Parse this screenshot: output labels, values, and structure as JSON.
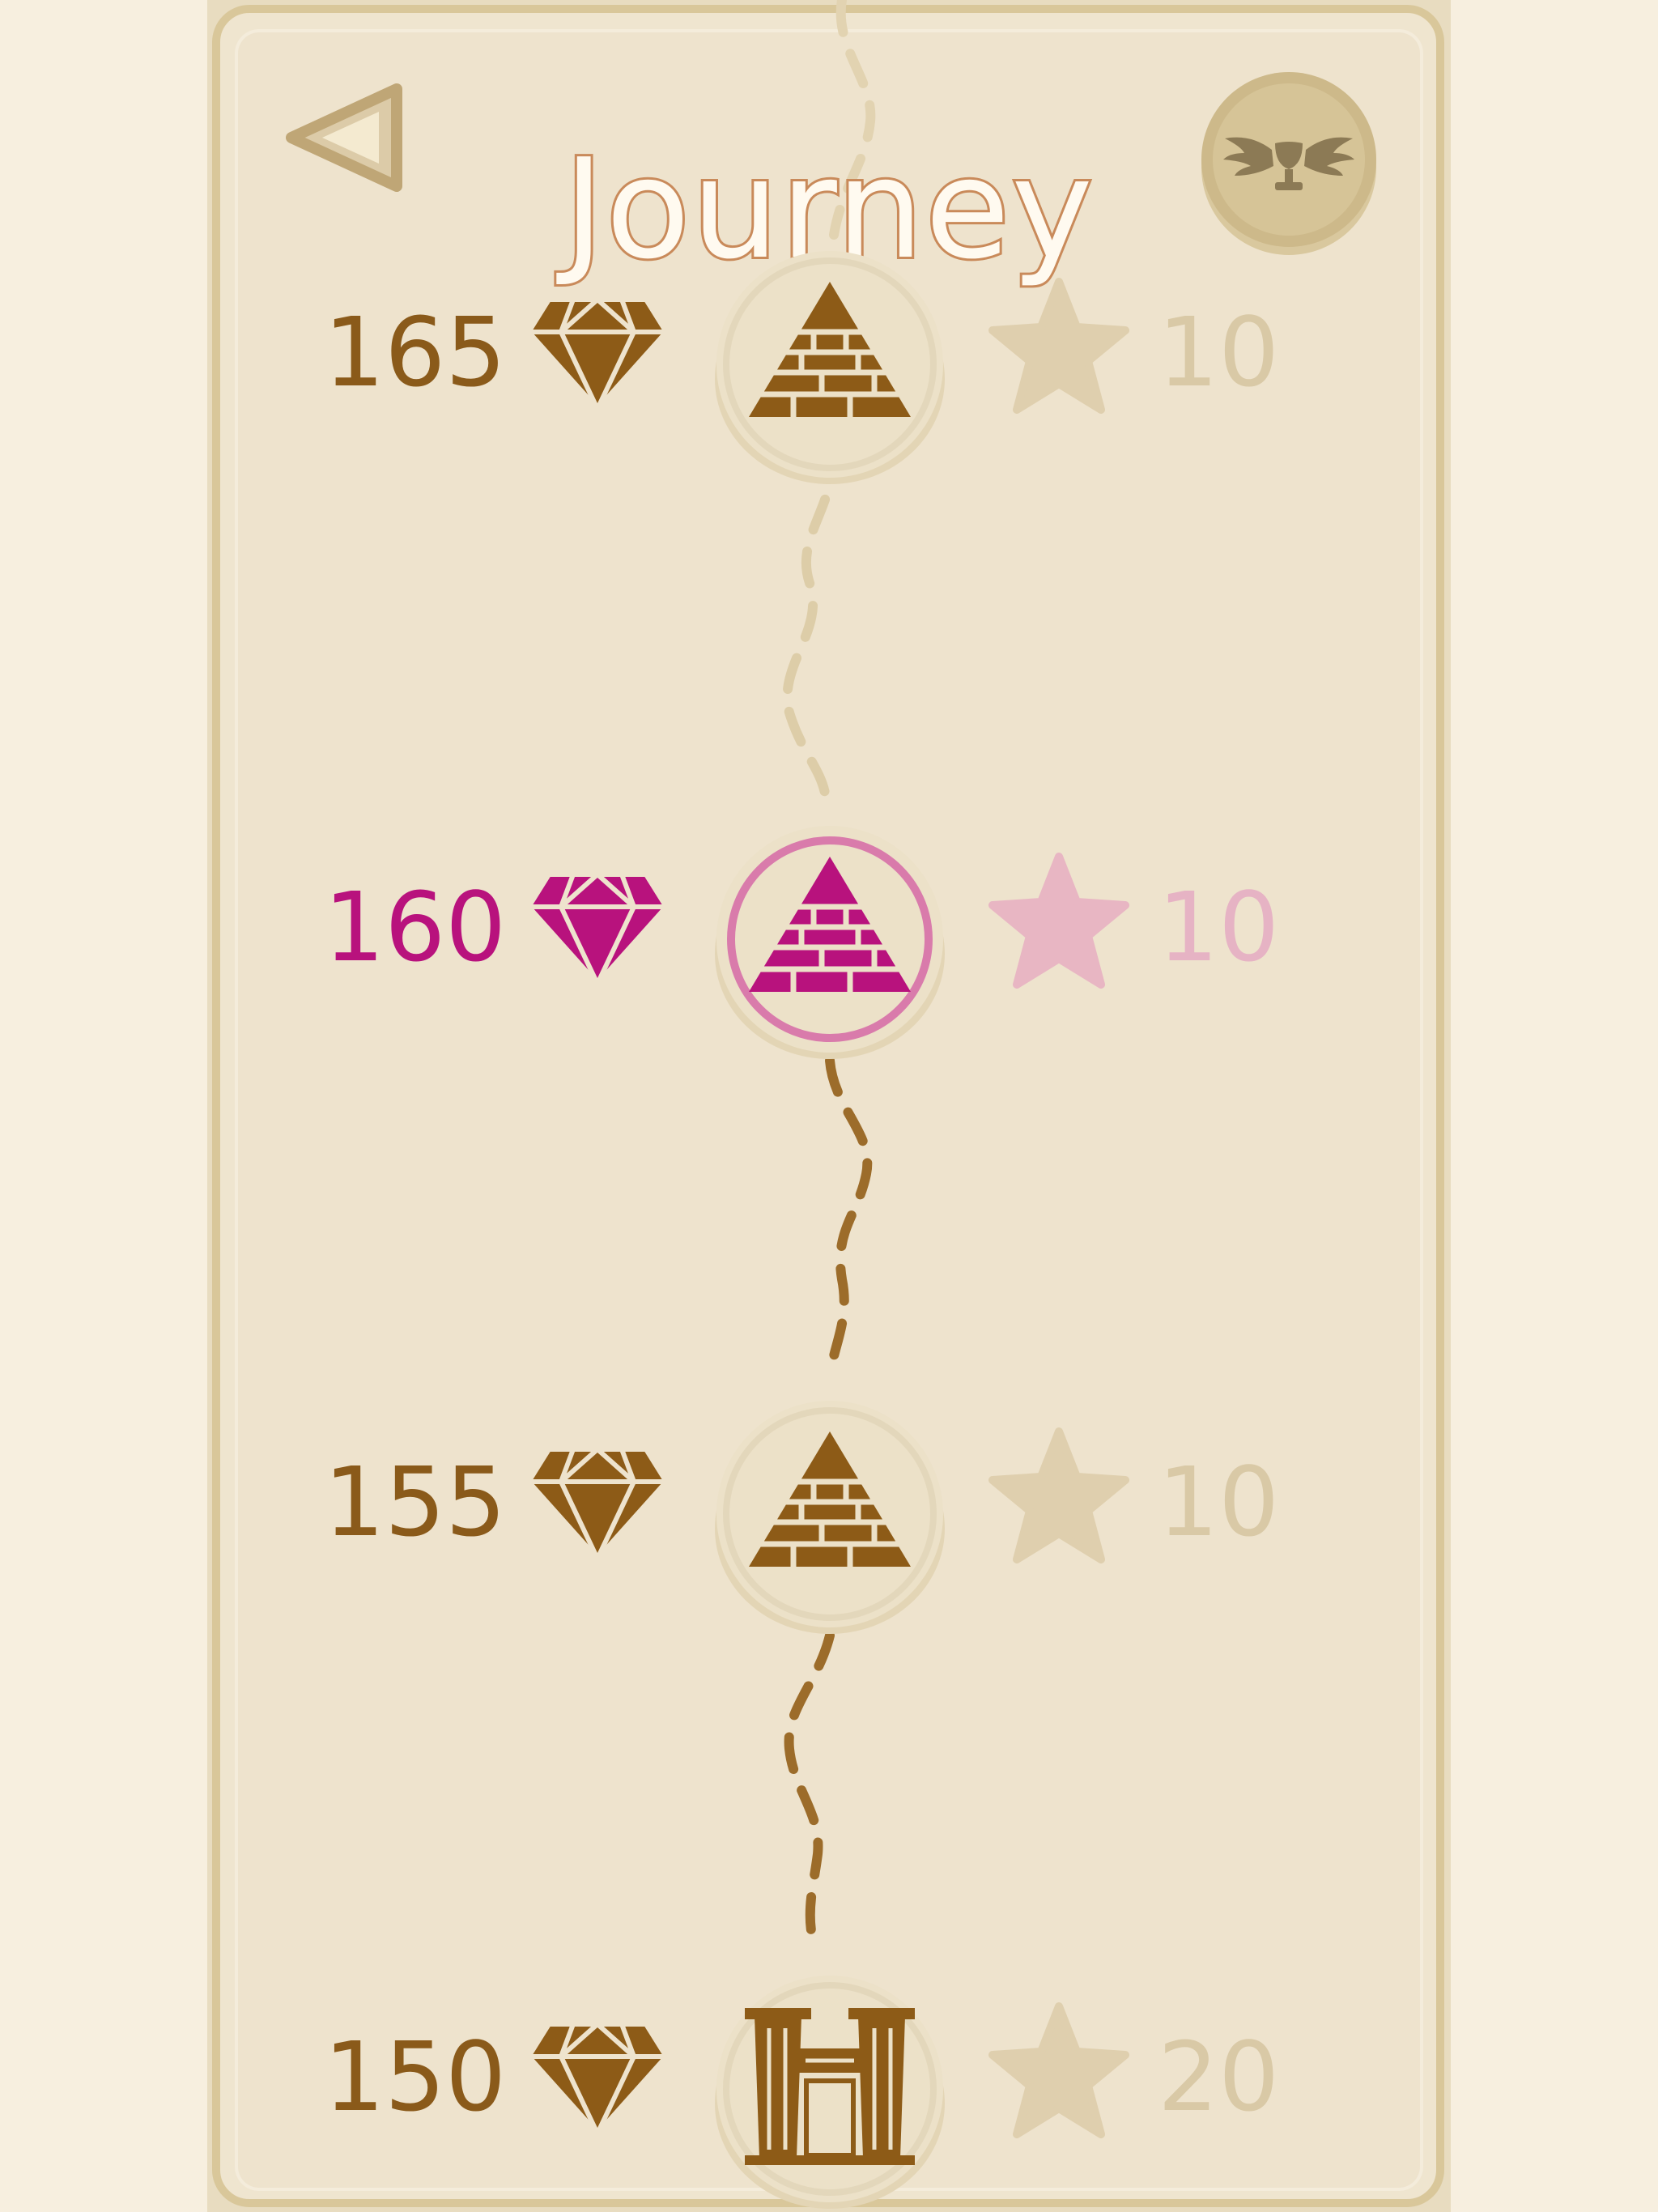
{
  "header": {
    "title": "Journey"
  },
  "colors": {
    "brown": "#8d5b17",
    "brown_text": "#8a5a1a",
    "magenta": "#b8127d",
    "pink_star": "#e8b6c3",
    "faded_star": "#dfcfae",
    "faded_text": "#d9c9a6",
    "path_light": "#dccba3",
    "path_dark": "#9c6c2a"
  },
  "levels": [
    {
      "cost": "165",
      "icon": "pyramid-icon",
      "stars": "10",
      "state": "locked"
    },
    {
      "cost": "160",
      "icon": "pyramid-icon",
      "stars": "10",
      "state": "current"
    },
    {
      "cost": "155",
      "icon": "pyramid-icon",
      "stars": "10",
      "state": "completed"
    },
    {
      "cost": "150",
      "icon": "temple-icon",
      "stars": "20",
      "state": "completed"
    }
  ],
  "icons": {
    "back": "back-arrow-icon",
    "trophy": "winged-trophy-icon",
    "gem": "diamond-icon",
    "star": "star-icon"
  }
}
